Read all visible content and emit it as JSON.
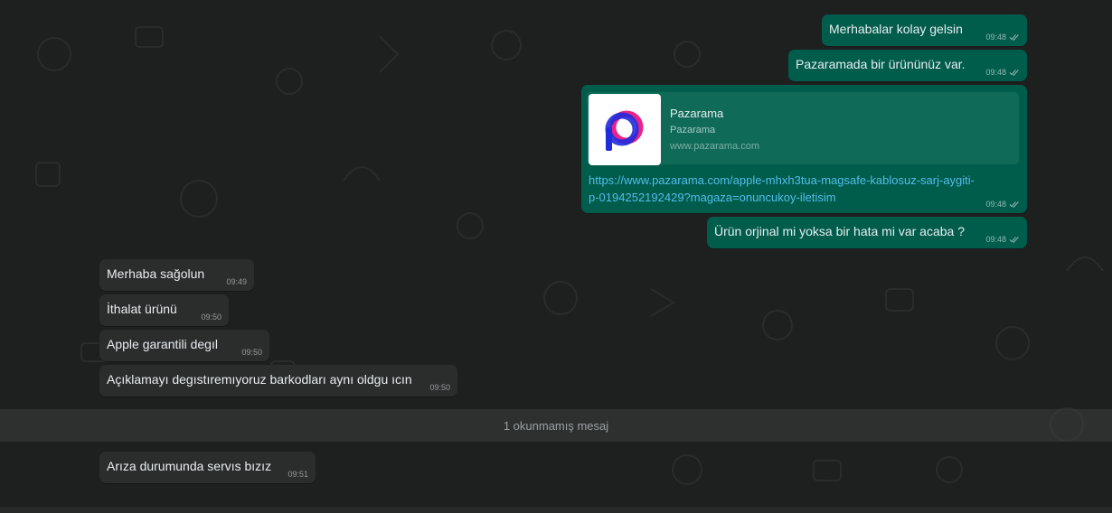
{
  "colors": {
    "chat_bg": "#1e2020",
    "outgoing_bubble": "#005c4b",
    "incoming_bubble": "#2b2d2d",
    "link_color": "#53bdeb"
  },
  "messages_out": [
    {
      "text": "Merhabalar kolay gelsin",
      "time": "09:48",
      "status_icon": "double-check-icon"
    },
    {
      "text": "Pazaramada bir ürününüz var.",
      "time": "09:48",
      "status_icon": "double-check-icon"
    },
    {
      "text": "Ürün orjinal mi yoksa bir hata mi var acaba ?",
      "time": "09:48",
      "status_icon": "double-check-icon"
    }
  ],
  "link_message": {
    "preview_title": "Pazarama",
    "preview_description": "Pazarama",
    "preview_domain": "www.pazarama.com",
    "url_line1": "https://www.pazarama.com/apple-mhxh3tua-magsafe-kablosuz-sarj-aygiti-",
    "url_line2": "p-0194252192429?magaza=onuncukoy-iletisim",
    "time": "09:48",
    "logo_icon": "pazarama-logo-icon"
  },
  "messages_in": [
    {
      "text": "Merhaba sağolun",
      "time": "09:49"
    },
    {
      "text": "İthalat ürünü",
      "time": "09:50"
    },
    {
      "text": "Apple garantili degıl",
      "time": "09:50"
    },
    {
      "text": "Açıklamayı degıstıremıyoruz barkodları aynı oldgu ıcın",
      "time": "09:50"
    }
  ],
  "unread_label": "1 okunmamış mesaj",
  "message_after_unread": {
    "text": "Arıza durumunda servıs bızız",
    "time": "09:51"
  }
}
